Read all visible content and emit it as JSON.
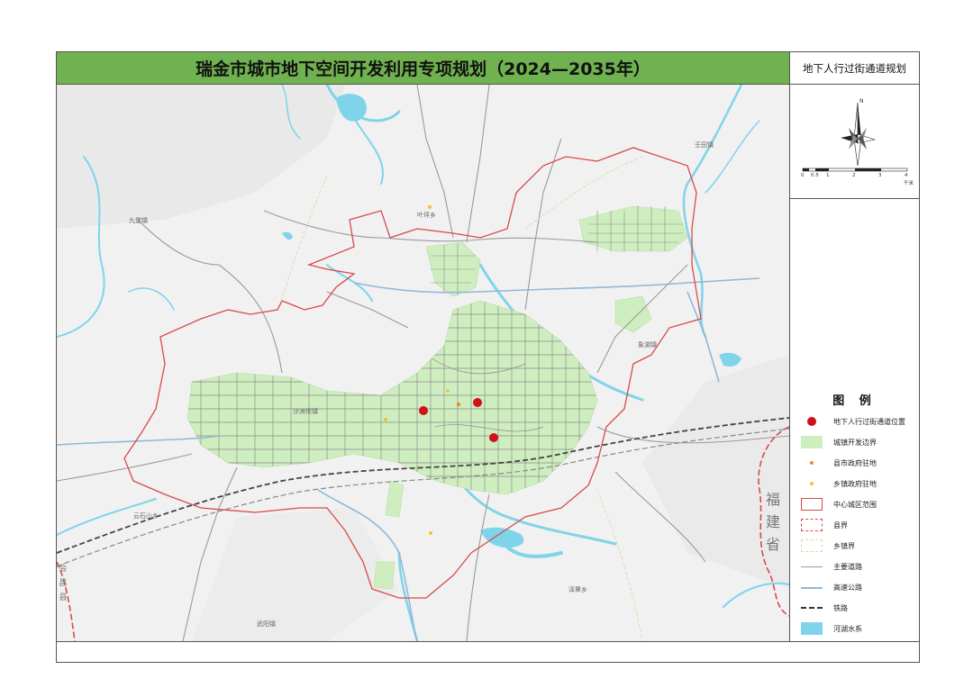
{
  "title": "瑞金市城市地下空间开发利用专项规划（2024—2035年）",
  "side_title": "地下人行过街通道规划",
  "scale_bar": {
    "ticks": [
      "0",
      "0.5",
      "1",
      "2",
      "3",
      "4"
    ],
    "unit": "千米"
  },
  "compass_label": "N",
  "legend": {
    "title": "图 例",
    "items": [
      {
        "symbol": "red-dot",
        "label": "地下人行过街通道位置"
      },
      {
        "symbol": "green-fill",
        "label": "城镇开发边界"
      },
      {
        "symbol": "orange-star",
        "label": "县市政府驻地"
      },
      {
        "symbol": "yellow-star",
        "label": "乡镇政府驻地"
      },
      {
        "symbol": "red-outline",
        "label": "中心城区范围"
      },
      {
        "symbol": "county-boundary",
        "label": "县界"
      },
      {
        "symbol": "township-boundary",
        "label": "乡镇界"
      },
      {
        "symbol": "grey-line",
        "label": "主要道路"
      },
      {
        "symbol": "blue-line",
        "label": "高速公路"
      },
      {
        "symbol": "railway",
        "label": "铁路"
      },
      {
        "symbol": "cyan-fill",
        "label": "河湖水系"
      }
    ]
  },
  "place_labels": {
    "jiubao": "九堡镇",
    "yetian": "叶坪乡",
    "sangtian": "沙洲坝镇",
    "rentian": "壬田镇",
    "yunshishan": "云石山乡",
    "wuyang": "武阳镇",
    "zetan": "泽覃乡",
    "xiangcun": "象湖镇",
    "fujian": "福建省",
    "huichang": "会昌县"
  },
  "colors": {
    "title_bg": "#6fb24f",
    "development_boundary": "#cfeec0",
    "central_boundary": "#d94a4a",
    "water": "#7fd4ea",
    "road": "#9a9a9a",
    "highway": "#8fb8d8",
    "marker": "#d0101a"
  },
  "markers": [
    {
      "name": "underpass-1"
    },
    {
      "name": "underpass-2"
    },
    {
      "name": "underpass-3"
    }
  ]
}
